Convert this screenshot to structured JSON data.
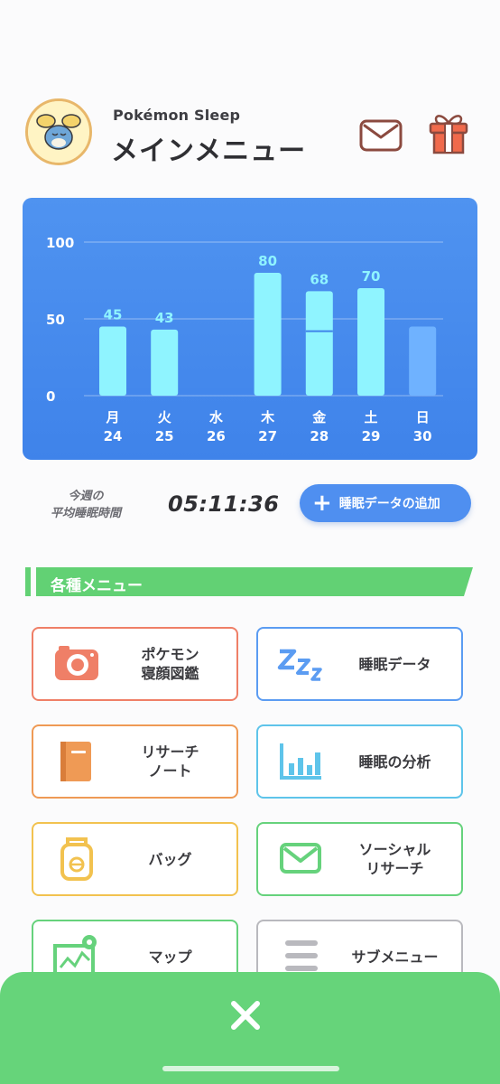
{
  "header": {
    "app_name": "Pokémon Sleep",
    "title": "メインメニュー",
    "avatar_icon": "pokemon-avatar-icon",
    "mail_icon": "mail-icon",
    "gift_icon": "gift-icon"
  },
  "chart_data": {
    "type": "bar",
    "categories": [
      "月 24",
      "火 25",
      "水 26",
      "木 27",
      "金 28",
      "土 29",
      "日 30"
    ],
    "weekdays": [
      "月",
      "火",
      "水",
      "木",
      "金",
      "土",
      "日"
    ],
    "days": [
      "24",
      "25",
      "26",
      "27",
      "28",
      "29",
      "30"
    ],
    "values": [
      45,
      43,
      null,
      80,
      68,
      70,
      null
    ],
    "labels": [
      "45",
      "43",
      "",
      "80",
      "68",
      "70",
      ""
    ],
    "ylim": [
      0,
      100
    ],
    "yticks": [
      "0",
      "50",
      "100"
    ],
    "grid": true,
    "bar_color": "#8ff4ff",
    "pending_bar_color": "#6fb2ff"
  },
  "summary": {
    "avg_label": "今週の\n平均睡眠時間",
    "avg_time": "05:11:36",
    "add_button": "睡眠データの追加"
  },
  "section": {
    "title": "各種メニュー",
    "color": "#62d174"
  },
  "menu": [
    {
      "label": "ポケモン\n寝顔図鑑",
      "icon": "camera-icon",
      "color": "#ef7f67"
    },
    {
      "label": "睡眠データ",
      "icon": "zzz-icon",
      "color": "#5b9cf2"
    },
    {
      "label": "リサーチ\nノート",
      "icon": "notebook-icon",
      "color": "#ef9a55"
    },
    {
      "label": "睡眠の分析",
      "icon": "bar-chart-icon",
      "color": "#5ec4ea"
    },
    {
      "label": "バッグ",
      "icon": "bag-icon",
      "color": "#f2c24f"
    },
    {
      "label": "ソーシャル\nリサーチ",
      "icon": "envelope-icon",
      "color": "#66d27c"
    },
    {
      "label": "マップ",
      "icon": "map-icon",
      "color": "#66d27c"
    },
    {
      "label": "サブメニュー",
      "icon": "hamburger-menu-icon",
      "color": "#9a9aa0"
    }
  ],
  "bottom_sheet": {
    "close_icon": "close-icon",
    "color": "#66d47a"
  }
}
